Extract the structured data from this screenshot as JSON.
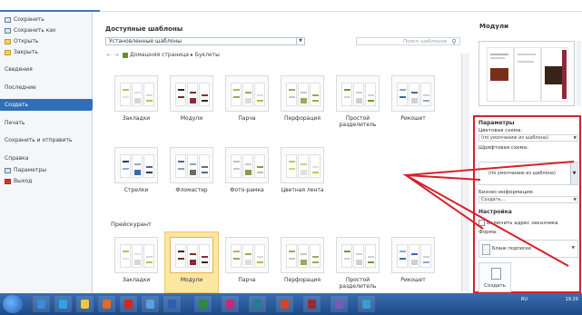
{
  "sidebar": {
    "save": "Сохранить",
    "save_as": "Сохранить как",
    "open": "Открыть",
    "close": "Закрыть",
    "info": "Сведения",
    "recent": "Последние",
    "create": "Создать",
    "print": "Печать",
    "save_send": "Сохранить и отправить",
    "help": "Справка",
    "options": "Параметры",
    "exit": "Выход"
  },
  "main": {
    "title": "Доступные шаблоны",
    "installed": "Установленные шаблоны",
    "search_placeholder": "Поиск шаблонов",
    "breadcrumb_home": "Домашняя страница",
    "breadcrumb_sep": "▸",
    "breadcrumb_current": "Буклеты",
    "row1": [
      "Закладки",
      "Модули",
      "Парча",
      "Перфорация",
      "Простой разделитель",
      "Рикошет"
    ],
    "row2": [
      "Стрелки",
      "Фломастер",
      "Фото-рамка",
      "Цветная лента"
    ],
    "section2": "Прейскурант",
    "row3": [
      "Закладки",
      "Модули",
      "Парча",
      "Перфорация",
      "Простой разделитель",
      "Рикошет"
    ]
  },
  "right": {
    "preview_title": "Модули",
    "params_title": "Параметры",
    "color_label": "Цветовая схема:",
    "color_value": "(по умолчанию из шаблона)",
    "font_label": "Шрифтовая схема:",
    "font_value": "(по умолчанию из шаблона)",
    "biz_label": "Бизнес-информация:",
    "biz_value": "Создать...",
    "settings_title": "Настройка",
    "include_address": "Включить адрес заказчика",
    "form_label": "Форма:",
    "form_value": "Бланк подписки",
    "create_btn": "Создать"
  },
  "taskbar": {
    "lang": "RU",
    "time": "19:29"
  },
  "colors": {
    "accent": "#2f6fb8",
    "highlight": "#d8202a",
    "selected_tile": "#fbe6a2"
  }
}
